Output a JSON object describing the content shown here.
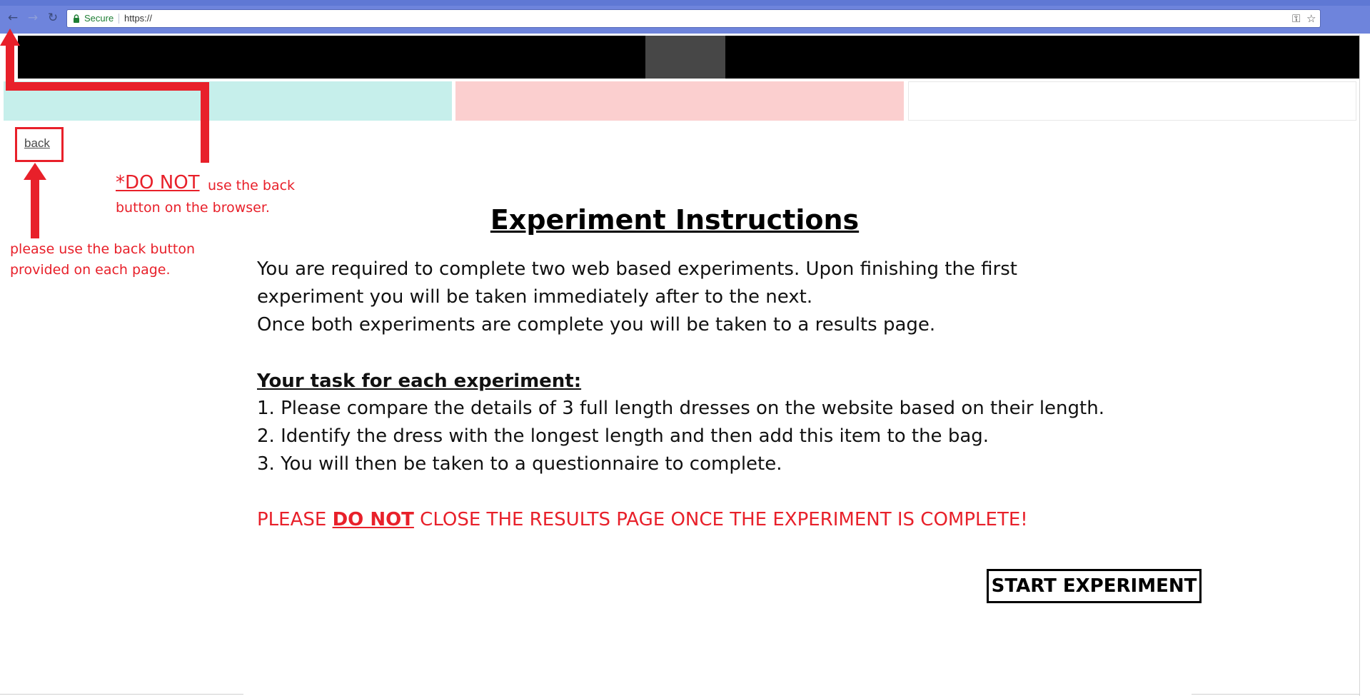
{
  "browser": {
    "back_icon": "←",
    "forward_icon": "→",
    "reload_icon": "↻",
    "secure_label": "Secure",
    "url": "https://",
    "key_icon": "⚿",
    "star_icon": "☆"
  },
  "nav": {
    "back_link": "back"
  },
  "annotations": {
    "do_not": "*DO NOT",
    "browser_line_1": "use the back",
    "browser_line_2": "button on the browser.",
    "provided_line_1": "please use the back button",
    "provided_line_2": "provided on each page.",
    "color": "#e8202a"
  },
  "content": {
    "title": "Experiment Instructions",
    "para_1": "You are required to complete two web based experiments. Upon finishing the first",
    "para_2": "experiment you will be taken immediately after to the next.",
    "para_3": "Once both experiments are complete you will be taken to a results page.",
    "task_heading": "Your task for each experiment:",
    "steps": [
      "1. Please compare the details of 3 full length dresses on the website based on their length.",
      "2. Identify the dress with the longest length and then add this item to the bag.",
      "3. You will then be taken to a questionnaire to complete."
    ],
    "warning_prefix": "PLEASE ",
    "warning_strong": "DO NOT",
    "warning_suffix": " CLOSE THE RESULTS PAGE ONCE THE EXPERIMENT IS COMPLETE!",
    "start_button": "START EXPERIMENT"
  },
  "colors": {
    "header": "#000000",
    "logo_block": "#474747",
    "strip_teal": "#c6efeb",
    "strip_pink": "#fbcfcf",
    "strip_white": "#ffffff",
    "chrome": "#6e84dc"
  }
}
